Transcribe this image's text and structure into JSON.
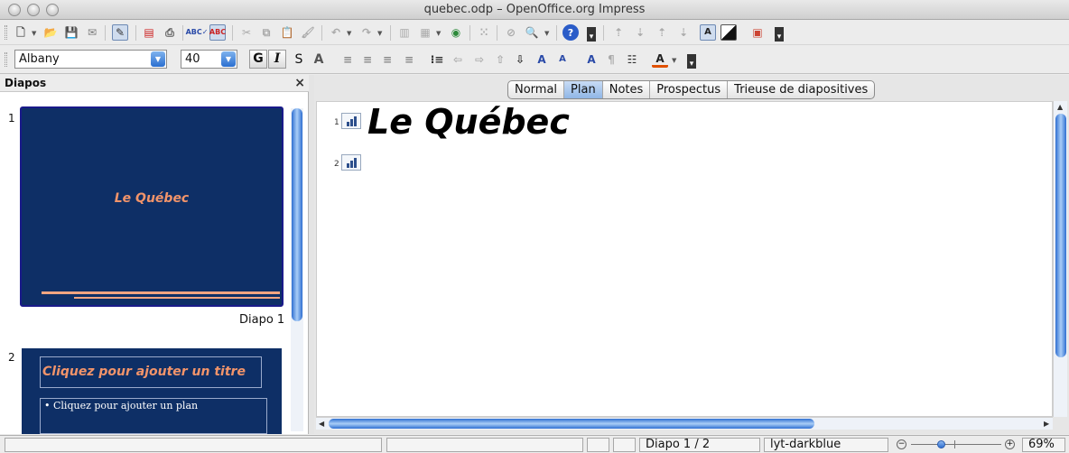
{
  "window": {
    "title": "quebec.odp – OpenOffice.org Impress"
  },
  "toolbar_standard": {
    "icons": [
      "new-icon",
      "open-icon",
      "save-icon",
      "email-icon",
      "edit-file-icon",
      "export-pdf-icon",
      "print-icon",
      "spellcheck-icon",
      "autospellcheck-icon",
      "cut-icon",
      "copy-icon",
      "paste-icon",
      "clone-format-icon",
      "undo-icon",
      "redo-icon",
      "chart-icon",
      "table-icon",
      "navigator-icon",
      "grid-icon",
      "show-draw-icon",
      "zoom-icon",
      "help-icon"
    ]
  },
  "toolbar_format": {
    "font_name": "Albany",
    "font_size": "40",
    "bold_label": "G",
    "italic_label": "I",
    "shadow_label": "S",
    "outline_label": "A"
  },
  "slides_pane": {
    "title": "Diapos",
    "close": "×",
    "slides": [
      {
        "number": "1",
        "title": "Le Québec",
        "caption": "Diapo 1"
      },
      {
        "number": "2",
        "title": "Cliquez pour ajouter un titre",
        "body": "• Cliquez pour ajouter un plan"
      }
    ]
  },
  "view_tabs": [
    {
      "label": "Normal",
      "active": false
    },
    {
      "label": "Plan",
      "active": true
    },
    {
      "label": "Notes",
      "active": false
    },
    {
      "label": "Prospectus",
      "active": false
    },
    {
      "label": "Trieuse de diapositives",
      "active": false
    }
  ],
  "outline": [
    {
      "number": "1",
      "text": "Le Québec"
    },
    {
      "number": "2",
      "text": ""
    }
  ],
  "statusbar": {
    "slide": "Diapo 1 / 2",
    "layout": "lyt-darkblue",
    "zoom": "69%",
    "zoom_minus": "−",
    "zoom_plus": "+"
  },
  "colors": {
    "slide_bg": "#0e2f66",
    "slide_title": "#f2946a",
    "accent": "#2f6fd1"
  }
}
